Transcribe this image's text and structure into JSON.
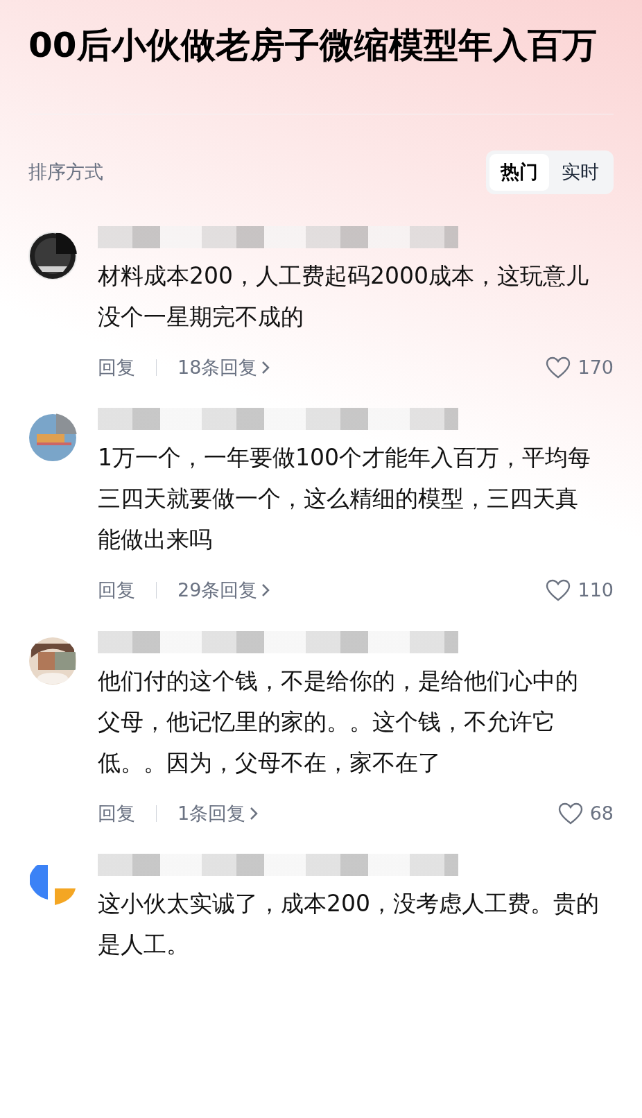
{
  "title": "00后小伙做老房子微缩模型年入百万",
  "sort": {
    "label": "排序方式",
    "options": [
      {
        "label": "热门",
        "selected": true
      },
      {
        "label": "实时",
        "selected": false
      }
    ]
  },
  "comments": [
    {
      "text": "材料成本200，人工费起码2000成本，这玩意儿没个一星期完不成的",
      "reply": "回复",
      "replies": "18条回复",
      "likes": "170"
    },
    {
      "text": "1万一个，一年要做100个才能年入百万，平均每三四天就要做一个，这么精细的模型，三四天真能做出来吗",
      "reply": "回复",
      "replies": "29条回复",
      "likes": "110"
    },
    {
      "text": "他们付的这个钱，不是给你的，是给他们心中的父母，他记忆里的家的。。这个钱，不允许它低。。因为，父母不在，家不在了",
      "reply": "回复",
      "replies": "1条回复",
      "likes": "68"
    },
    {
      "text": "这小伙太实诚了，成本200，没考虑人工费。贵的是人工。"
    }
  ]
}
